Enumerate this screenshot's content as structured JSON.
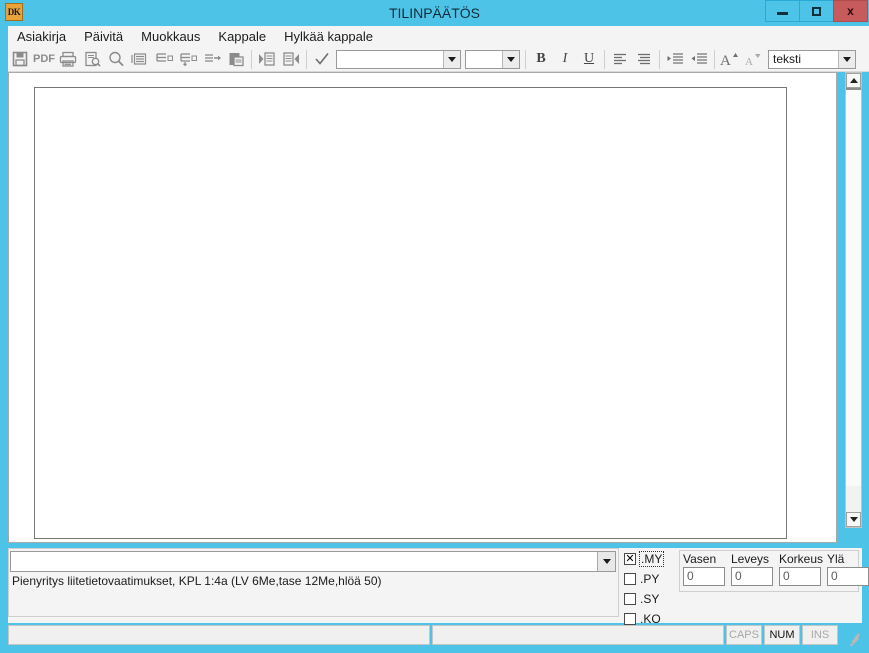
{
  "window": {
    "title": "TILINPÄÄTÖS",
    "app_icon_text": "DK",
    "controls": {
      "minimize": "minimize",
      "maximize": "maximize",
      "close": "x"
    },
    "accent_color": "#4ec3e8",
    "close_color": "#c75b5b"
  },
  "menubar": {
    "items": [
      {
        "label": "Asiakirja"
      },
      {
        "label": "Päivitä"
      },
      {
        "label": "Muokkaus"
      },
      {
        "label": "Kappale"
      },
      {
        "label": "Hylkää kappale"
      }
    ]
  },
  "toolbar": {
    "buttons": [
      {
        "name": "save-icon",
        "label": ""
      },
      {
        "name": "pdf-icon",
        "label": "PDF"
      },
      {
        "name": "print-icon",
        "label": ""
      },
      {
        "name": "print-preview-icon",
        "label": ""
      },
      {
        "name": "zoom-icon",
        "label": ""
      },
      {
        "name": "paragraph-format-icon",
        "label": ""
      },
      {
        "name": "paragraph-split-icon",
        "label": ""
      },
      {
        "name": "paragraph-merge-icon",
        "label": ""
      },
      {
        "name": "paragraph-move-icon",
        "label": ""
      },
      {
        "name": "paste-icon",
        "label": ""
      },
      {
        "name": "next-page-icon",
        "label": ""
      },
      {
        "name": "prev-page-icon",
        "label": ""
      },
      {
        "name": "confirm-check-icon",
        "label": ""
      }
    ],
    "font_combo": {
      "value": "",
      "placeholder": ""
    },
    "size_combo": {
      "value": "",
      "placeholder": ""
    },
    "bold_label": "B",
    "italic_label": "I",
    "underline_label": "U",
    "align_left": "align-left",
    "align_justify": "align-justify",
    "indent_increase": "indent-increase",
    "indent_decrease": "indent-decrease",
    "font_grow": "A",
    "font_shrink": "A",
    "style_combo": {
      "value": "teksti"
    }
  },
  "document": {
    "page_content": ""
  },
  "scrollbar": {
    "up_label": "scroll-up",
    "down_label": "scroll-down"
  },
  "bottom_panel": {
    "selector": {
      "value": ""
    },
    "hint_text": "Pienyritys liitetietovaatimukset, KPL 1:4a (LV 6Me,tase 12Me,hlöä 50)",
    "checkboxes": [
      {
        "label": ".MY",
        "checked": true,
        "mark": "✕"
      },
      {
        "label": ".PY",
        "checked": false,
        "mark": ""
      },
      {
        "label": ".SY",
        "checked": false,
        "mark": ""
      },
      {
        "label": ".KO",
        "checked": false,
        "mark": ""
      }
    ],
    "geometry": [
      {
        "label": "Vasen",
        "value": "0"
      },
      {
        "label": "Leveys",
        "value": "0"
      },
      {
        "label": "Korkeus",
        "value": "0"
      },
      {
        "label": "Ylä",
        "value": "0"
      }
    ]
  },
  "statusbar": {
    "main_text": "",
    "secondary_text": "",
    "indicators": [
      {
        "label": "CAPS",
        "active": false
      },
      {
        "label": "NUM",
        "active": true
      },
      {
        "label": "INS",
        "active": false
      }
    ]
  }
}
